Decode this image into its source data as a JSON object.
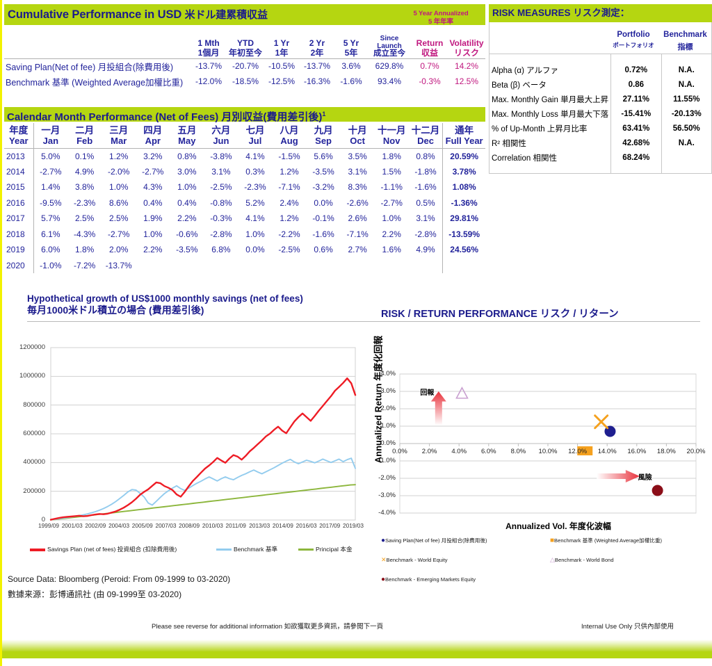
{
  "cumulative": {
    "header_en": "Cumulative Performance in USD",
    "header_jp": "米ドル建累積収益",
    "annual_en": "5 Year Annualized",
    "annual_jp": "5 年年率",
    "columns": [
      {
        "en": "1 Mth",
        "jp": "1個月"
      },
      {
        "en": "YTD",
        "jp": "年初至今"
      },
      {
        "en": "1 Yr",
        "jp": "1年"
      },
      {
        "en": "2 Yr",
        "jp": "2年"
      },
      {
        "en": "5 Yr",
        "jp": "5年"
      },
      {
        "en": "Since Launch",
        "jp": "成立至今"
      },
      {
        "en": "Return",
        "jp": "収益"
      },
      {
        "en": "Volatility",
        "jp": "リスク"
      }
    ],
    "rows": [
      {
        "label": "Saving Plan(Net of fee) 月投組合(除費用後)",
        "values": [
          "-13.7%",
          "-20.7%",
          "-10.5%",
          "-13.7%",
          "3.6%",
          "629.8%",
          "0.7%",
          "14.2%"
        ]
      },
      {
        "label": "Benchmark 基準 (Weighted Average加權比重)",
        "values": [
          "-12.0%",
          "-18.5%",
          "-12.5%",
          "-16.3%",
          "-1.6%",
          "93.4%",
          "-0.3%",
          "12.5%"
        ]
      }
    ]
  },
  "calendar": {
    "header": "Calendar Month Performance (Net of Fees)  月別収益(費用差引後)",
    "footnote_marker": "1",
    "col_year": {
      "jp": "年度",
      "en": "Year"
    },
    "col_full": {
      "jp": "通年",
      "en": "Full Year"
    },
    "months": [
      {
        "jp": "一月",
        "en": "Jan"
      },
      {
        "jp": "二月",
        "en": "Feb"
      },
      {
        "jp": "三月",
        "en": "Mar"
      },
      {
        "jp": "四月",
        "en": "Apr"
      },
      {
        "jp": "五月",
        "en": "May"
      },
      {
        "jp": "六月",
        "en": "Jun"
      },
      {
        "jp": "七月",
        "en": "Jul"
      },
      {
        "jp": "八月",
        "en": "Aug"
      },
      {
        "jp": "九月",
        "en": "Sep"
      },
      {
        "jp": "十月",
        "en": "Oct"
      },
      {
        "jp": "十一月",
        "en": "Nov"
      },
      {
        "jp": "十二月",
        "en": "Dec"
      }
    ],
    "rows": [
      {
        "year": "2013",
        "months": [
          "5.0%",
          "0.1%",
          "1.2%",
          "3.2%",
          "0.8%",
          "-3.8%",
          "4.1%",
          "-1.5%",
          "5.6%",
          "3.5%",
          "1.8%",
          "0.8%"
        ],
        "full": "20.59%"
      },
      {
        "year": "2014",
        "months": [
          "-2.7%",
          "4.9%",
          "-2.0%",
          "-2.7%",
          "3.0%",
          "3.1%",
          "0.3%",
          "1.2%",
          "-3.5%",
          "3.1%",
          "1.5%",
          "-1.8%"
        ],
        "full": "3.78%"
      },
      {
        "year": "2015",
        "months": [
          "1.4%",
          "3.8%",
          "1.0%",
          "4.3%",
          "1.0%",
          "-2.5%",
          "-2.3%",
          "-7.1%",
          "-3.2%",
          "8.3%",
          "-1.1%",
          "-1.6%"
        ],
        "full": "1.08%"
      },
      {
        "year": "2016",
        "months": [
          "-9.5%",
          "-2.3%",
          "8.6%",
          "0.4%",
          "0.4%",
          "-0.8%",
          "5.2%",
          "2.4%",
          "0.0%",
          "-2.6%",
          "-2.7%",
          "0.5%"
        ],
        "full": "-1.36%"
      },
      {
        "year": "2017",
        "months": [
          "5.7%",
          "2.5%",
          "2.5%",
          "1.9%",
          "2.2%",
          "-0.3%",
          "4.1%",
          "1.2%",
          "-0.1%",
          "2.6%",
          "1.0%",
          "3.1%"
        ],
        "full": "29.81%"
      },
      {
        "year": "2018",
        "months": [
          "6.1%",
          "-4.3%",
          "-2.7%",
          "1.0%",
          "-0.6%",
          "-2.8%",
          "1.0%",
          "-2.2%",
          "-1.6%",
          "-7.1%",
          "2.2%",
          "-2.8%"
        ],
        "full": "-13.59%"
      },
      {
        "year": "2019",
        "months": [
          "6.0%",
          "1.8%",
          "2.0%",
          "2.2%",
          "-3.5%",
          "6.8%",
          "0.0%",
          "-2.5%",
          "0.6%",
          "2.7%",
          "1.6%",
          "4.9%"
        ],
        "full": "24.56%"
      },
      {
        "year": "2020",
        "months": [
          "-1.0%",
          "-7.2%",
          "-13.7%",
          "",
          "",
          "",
          "",
          "",
          "",
          "",
          "",
          ""
        ],
        "full": ""
      }
    ]
  },
  "risk": {
    "header_en": "RISK MEASURES",
    "header_jp": "リスク測定：",
    "col_portfolio_en": "Portfolio",
    "col_portfolio_jp": "ポートフォリオ",
    "col_benchmark_en": "Benchmark",
    "col_benchmark_jp": "指標",
    "rows": [
      {
        "label": "Alpha (α) アルファ",
        "portfolio": "0.72%",
        "benchmark": "N.A."
      },
      {
        "label": "Beta (β) ベータ",
        "portfolio": "0.86",
        "benchmark": "N.A."
      },
      {
        "label": "Max. Monthly Gain 単月最大上昇",
        "portfolio": "27.11%",
        "benchmark": "11.55%"
      },
      {
        "label": "Max. Monthly Loss 単月最大下落",
        "portfolio": "-15.41%",
        "benchmark": "-20.13%"
      },
      {
        "label": "% of Up-Month 上昇月比率",
        "portfolio": "63.41%",
        "benchmark": "56.50%"
      },
      {
        "label": "R² 相関性",
        "portfolio": "42.68%",
        "benchmark": "N.A."
      },
      {
        "label": "Correlation 相関性",
        "portfolio": "68.24%",
        "benchmark": ""
      }
    ]
  },
  "line_chart_title": {
    "line1": "Hypothetical growth of US$1000 monthly savings (net of fees)",
    "line2": "毎月1000米ドル積立の場合 (費用差引後)"
  },
  "scatter_title": {
    "en": "RISK / RETURN PERFORMANCE",
    "jp": "リスク / リターン"
  },
  "source": {
    "line1": "Source Data: Bloomberg (Peroid: From 09-1999 to 03-2020)",
    "line2": "數據来源：彭博通訊社 (由 09-1999至 03-2020)"
  },
  "footer": {
    "note": "Please see reverse for additional information  如欲獲取更多資訊，請參閲下一頁",
    "internal": "Internal Use Only 只供內部使用"
  },
  "colors": {
    "green_header": "#b5d611",
    "navy_text": "#22239b",
    "magenta_text": "#c0187f",
    "savings_red": "#ee1c25",
    "benchmark_blue": "#93ccee",
    "principal_green": "#8cb63c",
    "left_border_yellow": "#f2f200",
    "scatter_navy": "#1f1f8f",
    "scatter_orange": "#f5a11e",
    "scatter_lilac": "#c9a0d0",
    "scatter_darkred": "#8b0e18"
  },
  "chart_data": [
    {
      "type": "line",
      "title": "Hypothetical growth of US$1000 monthly savings (net of fees) 毎月1000米ドル積立の場合 (費用差引後)",
      "xlabel": "",
      "ylabel": "",
      "ylim": [
        0,
        1200000
      ],
      "yticks": [
        0,
        200000,
        400000,
        600000,
        800000,
        1000000,
        1200000
      ],
      "ytick_labels": [
        "0",
        "200000",
        "400000",
        "600000",
        "800000",
        "1000000",
        "1200000"
      ],
      "xtick_labels": [
        "1999/09",
        "2001/03",
        "2002/09",
        "2004/03",
        "2005/09",
        "2007/03",
        "2008/09",
        "2010/03",
        "2011/09",
        "2013/03",
        "2014/09",
        "2016/03",
        "2017/09",
        "2019/03"
      ],
      "grid": true,
      "legend_position": "bottom",
      "series": [
        {
          "name": "Savings Plan  (net of fees) 投資組合 (扣除費用後)",
          "color": "#ee1c25",
          "values": [
            2000,
            8000,
            14000,
            19000,
            22000,
            24000,
            27000,
            30000,
            26000,
            28000,
            34000,
            38000,
            42000,
            40000,
            44000,
            52000,
            60000,
            72000,
            86000,
            104000,
            124000,
            148000,
            176000,
            196000,
            214000,
            238000,
            262000,
            256000,
            236000,
            224000,
            208000,
            178000,
            162000,
            196000,
            236000,
            272000,
            300000,
            330000,
            358000,
            380000,
            404000,
            432000,
            414000,
            398000,
            428000,
            452000,
            442000,
            420000,
            446000,
            478000,
            502000,
            528000,
            554000,
            582000,
            602000,
            628000,
            650000,
            622000,
            604000,
            646000,
            686000,
            716000,
            742000,
            716000,
            690000,
            724000,
            760000,
            794000,
            828000,
            862000,
            900000,
            926000,
            954000,
            986000,
            952000,
            870000
          ]
        },
        {
          "name": "Benchmark 基準",
          "color": "#93ccee",
          "values": [
            1500,
            5000,
            9000,
            13000,
            17000,
            21000,
            25000,
            30000,
            36000,
            42000,
            50000,
            58000,
            68000,
            80000,
            94000,
            110000,
            128000,
            150000,
            172000,
            196000,
            212000,
            208000,
            186000,
            160000,
            118000,
            104000,
            130000,
            158000,
            184000,
            204000,
            222000,
            238000,
            218000,
            206000,
            222000,
            240000,
            256000,
            270000,
            286000,
            300000,
            286000,
            272000,
            288000,
            300000,
            288000,
            280000,
            296000,
            310000,
            322000,
            336000,
            348000,
            334000,
            322000,
            336000,
            350000,
            364000,
            380000,
            396000,
            410000,
            422000,
            404000,
            392000,
            404000,
            416000,
            408000,
            398000,
            410000,
            424000,
            412000,
            400000,
            412000,
            424000,
            406000,
            420000,
            430000,
            360000
          ]
        },
        {
          "name": "Principal 本金",
          "color": "#8cb63c",
          "values": [
            1000,
            4000,
            8000,
            12000,
            16000,
            20000,
            24000,
            28000,
            32000,
            36000,
            40000,
            44000,
            48000,
            52000,
            56000,
            60000,
            64000,
            68000,
            72000,
            76000,
            80000,
            84000,
            88000,
            92000,
            96000,
            100000,
            104000,
            108000,
            112000,
            116000,
            120000,
            124000,
            128000,
            132000,
            136000,
            140000,
            144000,
            148000,
            152000,
            156000,
            160000,
            164000,
            168000,
            172000,
            176000,
            180000,
            184000,
            188000,
            192000,
            196000,
            200000,
            204000,
            208000,
            212000,
            216000,
            220000,
            224000,
            228000,
            232000,
            236000,
            240000,
            244000,
            246000
          ]
        }
      ]
    },
    {
      "type": "scatter",
      "title": "RISK / RETURN PERFORMANCE リスク / リターン",
      "xlabel": "Annualized Vol. 年度化波幅",
      "ylabel": "Annualized Return 年度化回報",
      "xlim": [
        0,
        20
      ],
      "ylim": [
        -4,
        4
      ],
      "xticks": [
        0,
        2,
        4,
        6,
        8,
        10,
        12,
        14,
        16,
        18,
        20
      ],
      "xtick_labels": [
        "0.0%",
        "2.0%",
        "4.0%",
        "6.0%",
        "8.0%",
        "10.0%",
        "12.0%",
        "14.0%",
        "16.0%",
        "18.0%",
        "20.0%"
      ],
      "yticks": [
        -4,
        -3,
        -2,
        -1,
        0,
        1,
        2,
        3,
        4
      ],
      "ytick_labels": [
        "-4.0%",
        "-3.0%",
        "-2.0%",
        "-1.0%",
        "0.0%",
        "1.0%",
        "2.0%",
        "3.0%",
        "4.0%"
      ],
      "grid": true,
      "points": [
        {
          "name": "Saving Plan(Net of fee) 月投組合(除費用後)",
          "x": 14.2,
          "y": 0.7,
          "marker": "circle",
          "color": "#1f1f8f"
        },
        {
          "name": "Benchmark 基準 (Weighted Average加權比重)",
          "x": 12.5,
          "y": -0.3,
          "marker": "square",
          "color": "#f5a11e"
        },
        {
          "name": "Benchmark - World Equity",
          "x": 13.6,
          "y": 1.25,
          "marker": "x",
          "color": "#f5a11e"
        },
        {
          "name": "Benchmark - World Bond",
          "x": 4.2,
          "y": 2.85,
          "marker": "triangle",
          "color": "#c9a0d0"
        },
        {
          "name": "Benchmark - Emerging Markets Equity",
          "x": 17.4,
          "y": -2.7,
          "marker": "circle",
          "color": "#8b0e18"
        }
      ],
      "annotations": [
        {
          "text": "回報",
          "x": 2.6,
          "y": 2.95,
          "arrow": "up",
          "color": "#e8323c"
        },
        {
          "text": "風險",
          "x": 16.0,
          "y": -1.9,
          "arrow": "right",
          "color": "#e8323c"
        }
      ],
      "legend": [
        {
          "label": "Saving Plan(Net of fee) 月投組合(除費用後)",
          "marker": "circle",
          "color": "#1f1f8f"
        },
        {
          "label": "Benchmark 基準 (Weighted Average加權比重)",
          "marker": "square",
          "color": "#f5a11e"
        },
        {
          "label": "Benchmark - World Equity",
          "marker": "x",
          "color": "#f5a11e"
        },
        {
          "label": "Benchmark - World Bond",
          "marker": "triangle",
          "color": "#c9a0d0"
        },
        {
          "label": "Benchmark - Emerging Markets Equity",
          "marker": "circle",
          "color": "#8b0e18"
        }
      ]
    }
  ]
}
